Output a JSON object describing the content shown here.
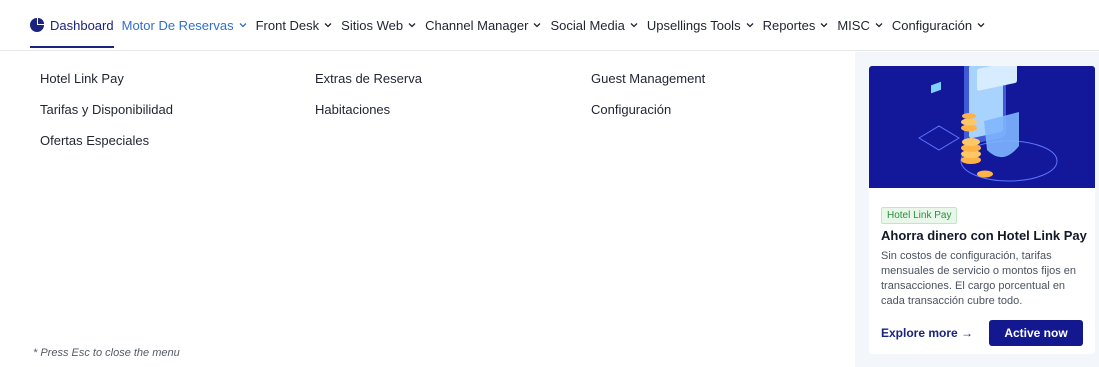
{
  "nav": {
    "items": [
      {
        "label": "Dashboard",
        "chevron": false
      },
      {
        "label": "Motor De Reservas",
        "chevron": true
      },
      {
        "label": "Front Desk",
        "chevron": true
      },
      {
        "label": "Sitios Web",
        "chevron": true
      },
      {
        "label": "Channel Manager",
        "chevron": true
      },
      {
        "label": "Social Media",
        "chevron": true
      },
      {
        "label": "Upsellings Tools",
        "chevron": true
      },
      {
        "label": "Reportes",
        "chevron": true
      },
      {
        "label": "MISC",
        "chevron": true
      },
      {
        "label": "Configuración",
        "chevron": true
      }
    ],
    "colors": {
      "active": "#1a237e",
      "open": "#2f6fcf"
    }
  },
  "menu": {
    "columns": [
      {
        "links": [
          "Hotel Link Pay",
          "Tarifas y Disponibilidad",
          "Ofertas Especiales"
        ]
      },
      {
        "links": [
          "Extras de Reserva",
          "Habitaciones"
        ]
      },
      {
        "links": [
          "Guest Management",
          "Configuración"
        ]
      }
    ],
    "hint": "* Press Esc to close the menu"
  },
  "promo": {
    "badge": "Hotel Link Pay",
    "title": "Ahorra dinero con Hotel Link Pay",
    "description": "Sin costos de configuración, tarifas mensuales de servicio o montos fijos en transacciones. El cargo porcentual en cada transacción cubre todo.",
    "explore_label": "Explore more →",
    "cta_label": "Active now",
    "colors": {
      "banner": "#13189a",
      "cta": "#13188f"
    }
  }
}
